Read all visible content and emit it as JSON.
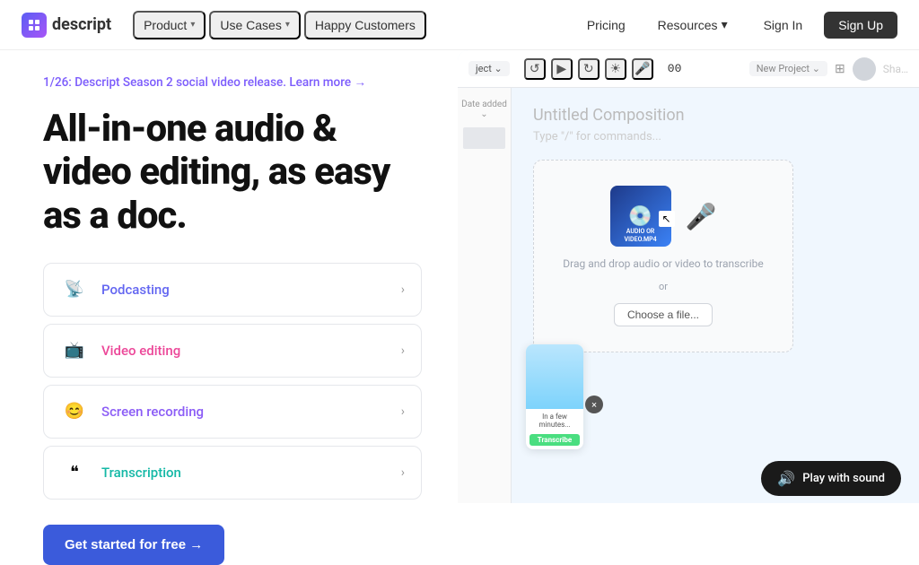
{
  "nav": {
    "logo_text": "descript",
    "links": [
      {
        "label": "Product",
        "has_dropdown": true
      },
      {
        "label": "Use Cases",
        "has_dropdown": true
      },
      {
        "label": "Happy Customers",
        "has_dropdown": false
      }
    ],
    "right_links": [
      {
        "label": "Pricing",
        "has_dropdown": false
      },
      {
        "label": "Resources",
        "has_dropdown": true
      },
      {
        "label": "Sign In",
        "has_dropdown": false
      },
      {
        "label": "Sign Up",
        "has_dropdown": false
      }
    ]
  },
  "announcement": {
    "text": "1/26: Descript Season 2 social video release. Learn more →"
  },
  "hero": {
    "title": "All-in-one audio & video editing, as easy as a doc."
  },
  "features": [
    {
      "id": "podcasting",
      "icon": "📡",
      "label": "Podcasting",
      "color_class": "podcasting-label"
    },
    {
      "id": "video-editing",
      "icon": "📺",
      "label": "Video editing",
      "color_class": "video-editing-label"
    },
    {
      "id": "screen-recording",
      "icon": "😊",
      "label": "Screen recording",
      "color_class": "screen-recording-label"
    },
    {
      "id": "transcription",
      "icon": "❝",
      "label": "Transcription",
      "color_class": "transcription-label"
    }
  ],
  "cta": {
    "label": "Get started for free →"
  },
  "app_mockup": {
    "toolbar": {
      "tag": "ject",
      "time": "00",
      "new_project": "New Project"
    },
    "composition_title": "Untitled Composition",
    "composition_hint": "Type \"/\" for commands...",
    "drop_zone": {
      "text": "Drag and drop audio or video to transcribe",
      "or": "or",
      "button_label": "Choose a file..."
    },
    "media_file_label": "AUDIO OR\nVIDEO.MP4",
    "play_btn_label": "Play with sound",
    "transcribe_label": "Transcribe"
  }
}
